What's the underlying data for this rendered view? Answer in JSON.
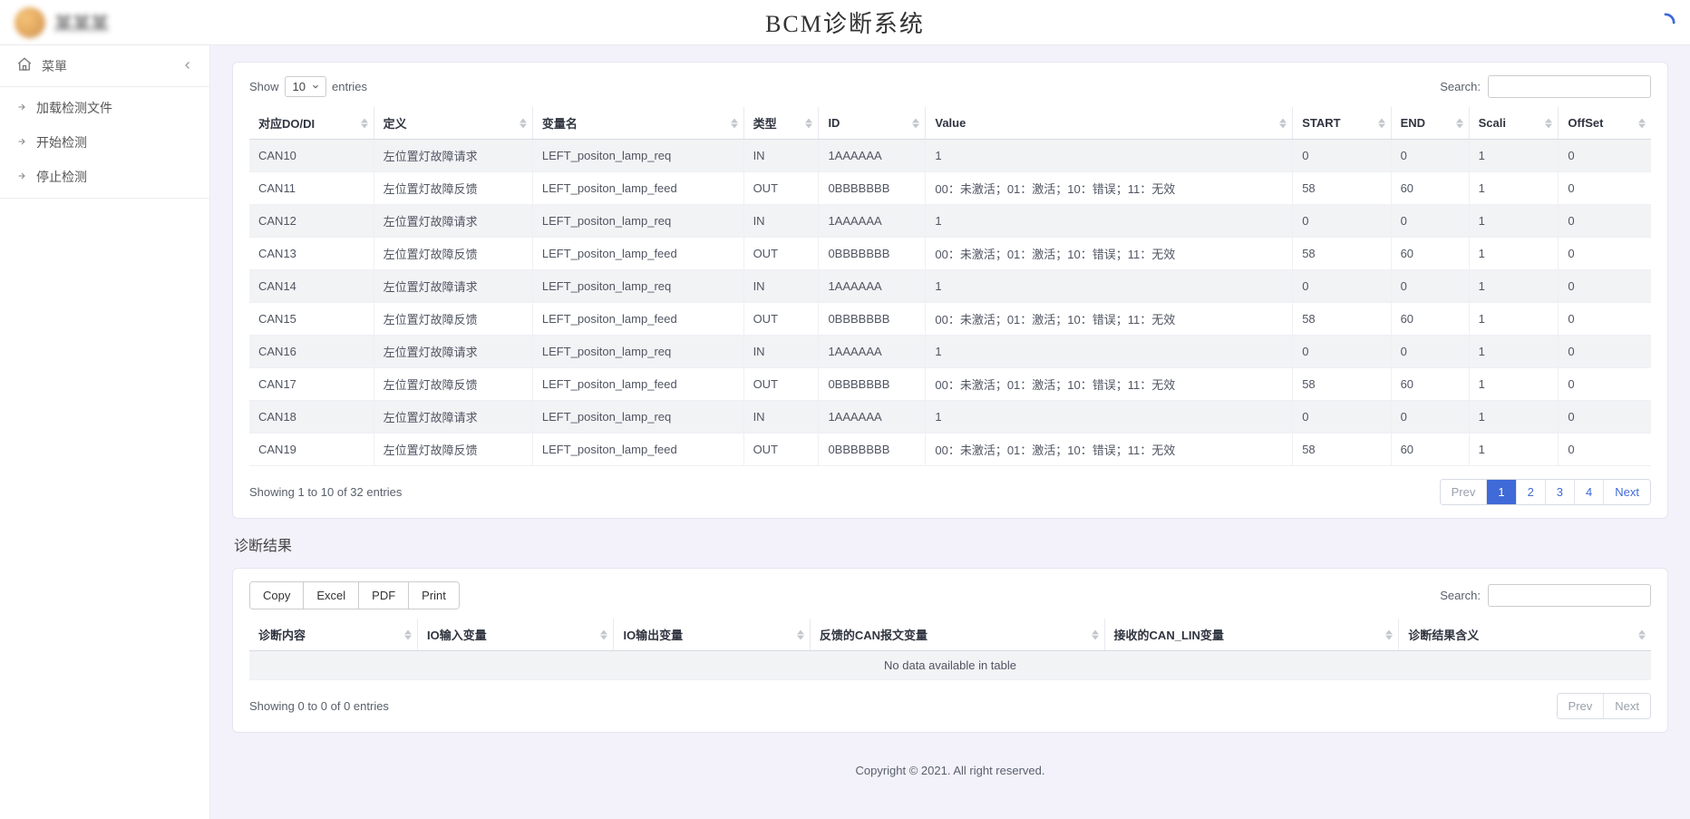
{
  "header": {
    "title": "BCM诊断系统",
    "logo_text": "某某某"
  },
  "sidebar": {
    "menu_label": "菜單",
    "items": [
      {
        "label": "加载检测文件"
      },
      {
        "label": "开始检测"
      },
      {
        "label": "停止检测"
      }
    ]
  },
  "table1": {
    "length": {
      "prefix": "Show",
      "value": "10",
      "suffix": "entries"
    },
    "search_label": "Search:",
    "columns": [
      "对应DO/DI",
      "定义",
      "变量名",
      "类型",
      "ID",
      "Value",
      "START",
      "END",
      "Scali",
      "OffSet"
    ],
    "rows": [
      [
        "CAN10",
        "左位置灯故障请求",
        "LEFT_positon_lamp_req",
        "IN",
        "1AAAAAA",
        "1",
        "0",
        "0",
        "1",
        "0"
      ],
      [
        "CAN11",
        "左位置灯故障反馈",
        "LEFT_positon_lamp_feed",
        "OUT",
        "0BBBBBBB",
        "00：未激活；01：激活；10：错误；11：无效",
        "58",
        "60",
        "1",
        "0"
      ],
      [
        "CAN12",
        "左位置灯故障请求",
        "LEFT_positon_lamp_req",
        "IN",
        "1AAAAAA",
        "1",
        "0",
        "0",
        "1",
        "0"
      ],
      [
        "CAN13",
        "左位置灯故障反馈",
        "LEFT_positon_lamp_feed",
        "OUT",
        "0BBBBBBB",
        "00：未激活；01：激活；10：错误；11：无效",
        "58",
        "60",
        "1",
        "0"
      ],
      [
        "CAN14",
        "左位置灯故障请求",
        "LEFT_positon_lamp_req",
        "IN",
        "1AAAAAA",
        "1",
        "0",
        "0",
        "1",
        "0"
      ],
      [
        "CAN15",
        "左位置灯故障反馈",
        "LEFT_positon_lamp_feed",
        "OUT",
        "0BBBBBBB",
        "00：未激活；01：激活；10：错误；11：无效",
        "58",
        "60",
        "1",
        "0"
      ],
      [
        "CAN16",
        "左位置灯故障请求",
        "LEFT_positon_lamp_req",
        "IN",
        "1AAAAAA",
        "1",
        "0",
        "0",
        "1",
        "0"
      ],
      [
        "CAN17",
        "左位置灯故障反馈",
        "LEFT_positon_lamp_feed",
        "OUT",
        "0BBBBBBB",
        "00：未激活；01：激活；10：错误；11：无效",
        "58",
        "60",
        "1",
        "0"
      ],
      [
        "CAN18",
        "左位置灯故障请求",
        "LEFT_positon_lamp_req",
        "IN",
        "1AAAAAA",
        "1",
        "0",
        "0",
        "1",
        "0"
      ],
      [
        "CAN19",
        "左位置灯故障反馈",
        "LEFT_positon_lamp_feed",
        "OUT",
        "0BBBBBBB",
        "00：未激活；01：激活；10：错误；11：无效",
        "58",
        "60",
        "1",
        "0"
      ]
    ],
    "info": "Showing 1 to 10 of 32 entries",
    "pagination": {
      "prev": "Prev",
      "pages": [
        "1",
        "2",
        "3",
        "4"
      ],
      "active": "1",
      "next": "Next"
    }
  },
  "section_results_title": "诊断结果",
  "table2": {
    "export": {
      "copy": "Copy",
      "excel": "Excel",
      "pdf": "PDF",
      "print": "Print"
    },
    "search_label": "Search:",
    "columns": [
      "诊断内容",
      "IO输入变量",
      "IO输出变量",
      "反馈的CAN报文变量",
      "接收的CAN_LIN变量",
      "诊断结果含义"
    ],
    "empty": "No data available in table",
    "info": "Showing 0 to 0 of 0 entries",
    "pagination": {
      "prev": "Prev",
      "next": "Next"
    }
  },
  "footer": "Copyright © 2021. All right reserved."
}
